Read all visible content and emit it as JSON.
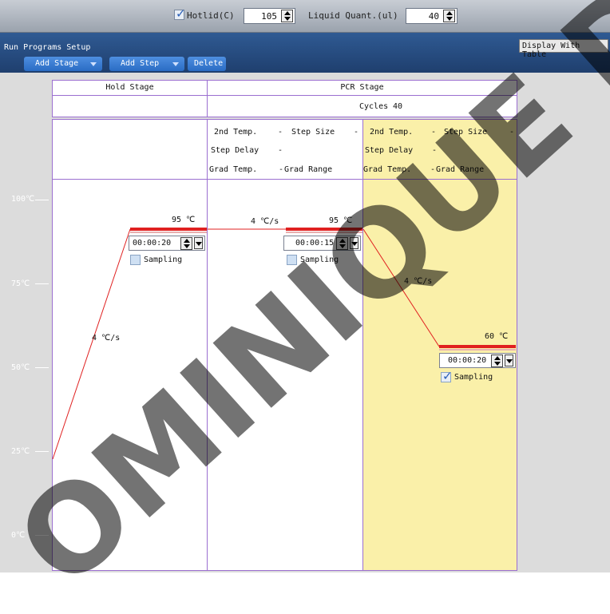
{
  "top_bar": {
    "hotlid_label": "Hotlid(C)",
    "hotlid_checked": true,
    "hotlid_value": "105",
    "liquid_label": "Liquid Quant.(ul)",
    "liquid_value": "40"
  },
  "header": {
    "title": "Run Programs Setup",
    "display_with_table": "Display With Table",
    "add_stage": "Add Stage",
    "add_step": "Add Step",
    "delete": "Delete"
  },
  "axis": {
    "labels": [
      "100℃",
      "75℃",
      "50℃",
      "25℃",
      "0℃"
    ]
  },
  "hold_stage": {
    "title": "Hold Stage",
    "ramp_rate": "4 ℃/s",
    "temp": "95 ℃",
    "time": "00:00:20",
    "sampling_label": "Sampling",
    "sampling_checked": false
  },
  "pcr_stage": {
    "title": "PCR Stage",
    "cycles_label": "Cycles",
    "cycles_value": "40",
    "step1": {
      "second_temp_label": "2nd Temp.",
      "second_temp_value": "-",
      "step_size_label": "Step Size",
      "step_size_value": "-",
      "step_delay_label": "Step Delay",
      "step_delay_value": "-",
      "grad_temp_label": "Grad Temp.",
      "grad_temp_value": "-",
      "grad_range_label": "Grad Range",
      "ramp_rate": "4 ℃/s",
      "temp": "95 ℃",
      "time": "00:00:15",
      "sampling_label": "Sampling",
      "sampling_checked": false
    },
    "step2": {
      "second_temp_label": "2nd Temp.",
      "second_temp_value": "-",
      "step_size_label": "Step Size",
      "step_size_value": "-",
      "step_delay_label": "Step Delay",
      "step_delay_value": "-",
      "grad_temp_label": "Grad Temp.",
      "grad_temp_value": "-",
      "grad_range_label": "Grad Range",
      "ramp_rate": "4 ℃/s",
      "temp": "60 ℃",
      "time": "00:00:20",
      "sampling_label": "Sampling",
      "sampling_checked": true
    }
  },
  "watermark": "OMINIQUE DUT",
  "colors": {
    "header_bg": "#24477a",
    "button_blue": "#3a7fd6",
    "stage_border": "#9b6fd0",
    "selected_step_bg": "#faf0a9",
    "temp_line": "#e02020"
  },
  "icons": {
    "spin": "up-down-spinner-icon",
    "dropdown": "chevron-down-icon",
    "check": "checkmark-icon"
  }
}
